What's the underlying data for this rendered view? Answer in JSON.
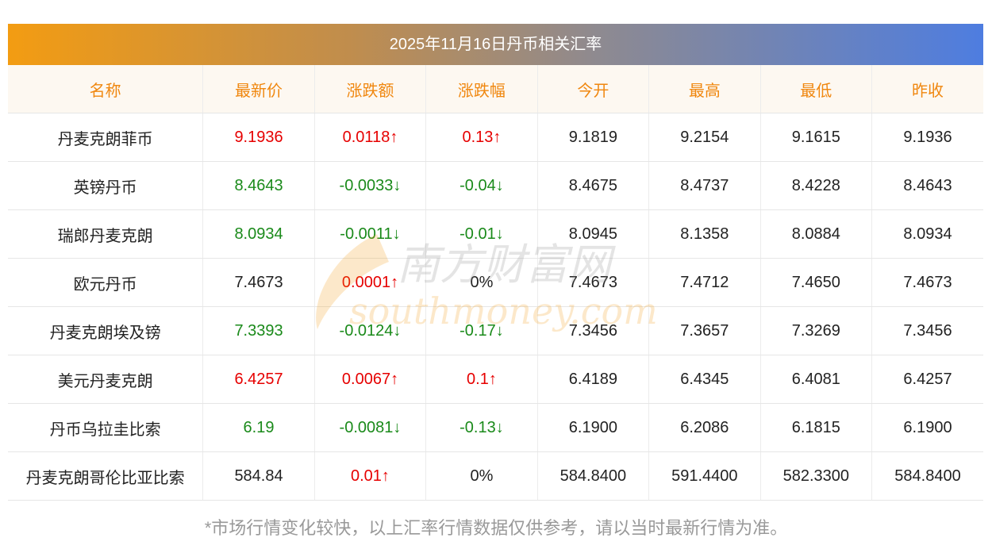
{
  "title": "2025年11月16日丹币相关汇率",
  "colors": {
    "up": "#e60000",
    "down": "#1a8a1a",
    "flat": "#222222",
    "header_text": "#f0870f",
    "header_bg": "#fdf8f1"
  },
  "columns": [
    "名称",
    "最新价",
    "涨跌额",
    "涨跌幅",
    "今开",
    "最高",
    "最低",
    "昨收"
  ],
  "rows": [
    {
      "name": "丹麦克朗菲币",
      "latest": "9.1936",
      "change": "0.0118↑",
      "pct": "0.13↑",
      "open": "9.1819",
      "high": "9.2154",
      "low": "9.1615",
      "prev": "9.1936",
      "trend": "up"
    },
    {
      "name": "英镑丹币",
      "latest": "8.4643",
      "change": "-0.0033↓",
      "pct": "-0.04↓",
      "open": "8.4675",
      "high": "8.4737",
      "low": "8.4228",
      "prev": "8.4643",
      "trend": "down"
    },
    {
      "name": "瑞郎丹麦克朗",
      "latest": "8.0934",
      "change": "-0.0011↓",
      "pct": "-0.01↓",
      "open": "8.0945",
      "high": "8.1358",
      "low": "8.0884",
      "prev": "8.0934",
      "trend": "down"
    },
    {
      "name": "欧元丹币",
      "latest": "7.4673",
      "change": "0.0001↑",
      "pct": "0%",
      "open": "7.4673",
      "high": "7.4712",
      "low": "7.4650",
      "prev": "7.4673",
      "trend": "flat_up"
    },
    {
      "name": "丹麦克朗埃及镑",
      "latest": "7.3393",
      "change": "-0.0124↓",
      "pct": "-0.17↓",
      "open": "7.3456",
      "high": "7.3657",
      "low": "7.3269",
      "prev": "7.3456",
      "trend": "down"
    },
    {
      "name": "美元丹麦克朗",
      "latest": "6.4257",
      "change": "0.0067↑",
      "pct": "0.1↑",
      "open": "6.4189",
      "high": "6.4345",
      "low": "6.4081",
      "prev": "6.4257",
      "trend": "up"
    },
    {
      "name": "丹币乌拉圭比索",
      "latest": "6.19",
      "change": "-0.0081↓",
      "pct": "-0.13↓",
      "open": "6.1900",
      "high": "6.2086",
      "low": "6.1815",
      "prev": "6.1900",
      "trend": "down"
    },
    {
      "name": "丹麦克朗哥伦比亚比索",
      "latest": "584.84",
      "change": "0.01↑",
      "pct": "0%",
      "open": "584.8400",
      "high": "591.4400",
      "low": "582.3300",
      "prev": "584.8400",
      "trend": "flat_up"
    }
  ],
  "watermark": {
    "cn": "南方财富网",
    "en": "southmoney.com"
  },
  "footnote": "*市场行情变化较快，以上汇率行情数据仅供参考，请以当时最新行情为准。"
}
